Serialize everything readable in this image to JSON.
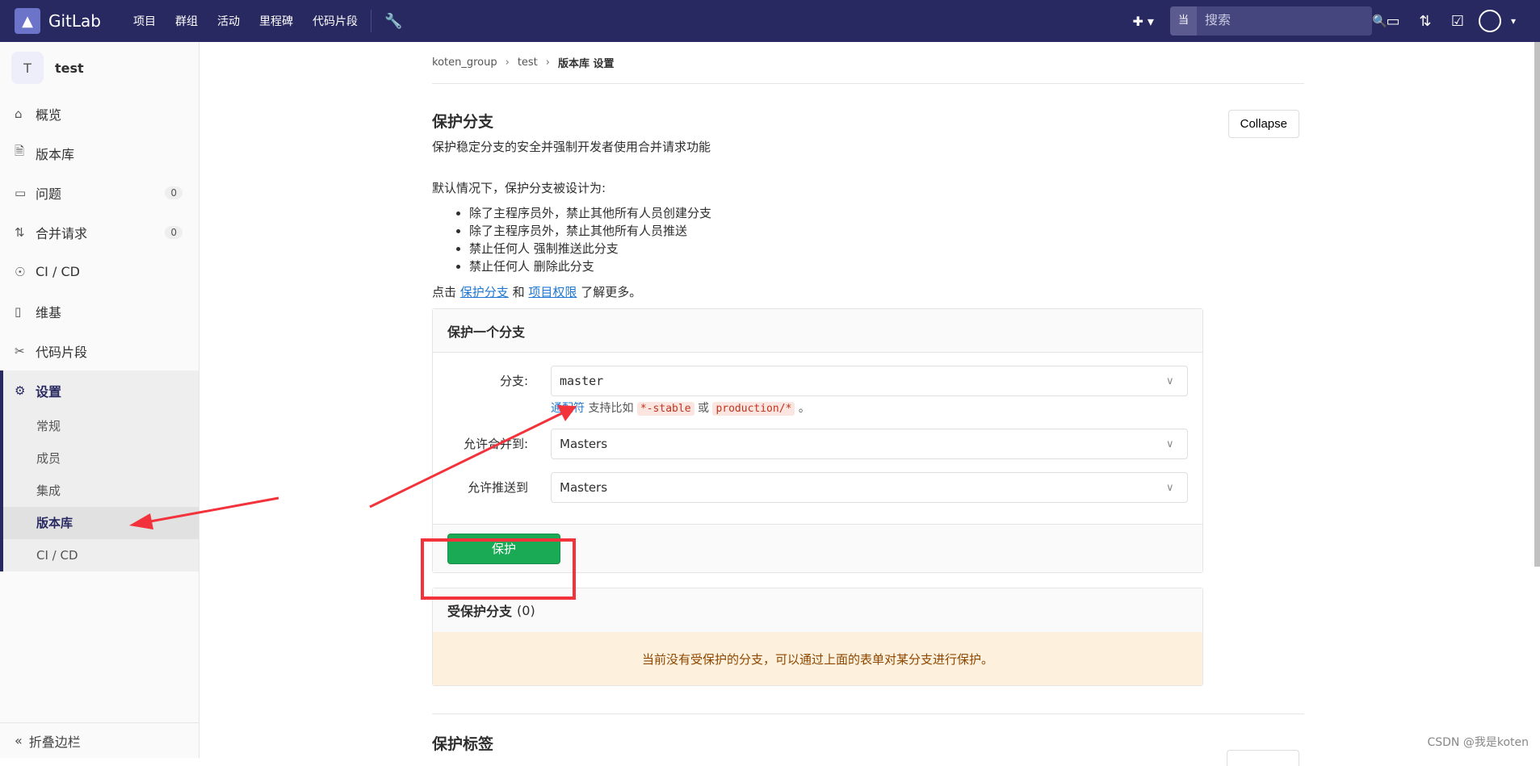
{
  "topbar": {
    "brand": "GitLab",
    "nav": [
      "项目",
      "群组",
      "活动",
      "里程碑",
      "代码片段"
    ],
    "search_scope": "当前项目",
    "search_placeholder": "搜索"
  },
  "sidebar": {
    "project_initial": "T",
    "project_name": "test",
    "items": [
      {
        "label": "概览",
        "icon": "home-icon"
      },
      {
        "label": "版本库",
        "icon": "doc-icon"
      },
      {
        "label": "问题",
        "icon": "issues-icon",
        "count": "0"
      },
      {
        "label": "合并请求",
        "icon": "merge-icon",
        "count": "0"
      },
      {
        "label": "CI / CD",
        "icon": "rocket-icon"
      },
      {
        "label": "维基",
        "icon": "book-icon"
      },
      {
        "label": "代码片段",
        "icon": "scissors-icon"
      }
    ],
    "settings_label": "设置",
    "settings_sub": [
      "常规",
      "成员",
      "集成",
      "版本库",
      "CI / CD"
    ],
    "collapse_label": "折叠边栏"
  },
  "breadcrumbs": [
    "koten_group",
    "test",
    "版本库 设置"
  ],
  "section": {
    "title": "保护分支",
    "desc": "保护稳定分支的安全并强制开发者使用合并请求功能",
    "collapse_label": "Collapse",
    "defaults_intro": "默认情况下，保护分支被设计为:",
    "rules": [
      "除了主程序员外，禁止其他所有人员创建分支",
      "除了主程序员外，禁止其他所有人员推送",
      "禁止任何人 强制推送此分支",
      "禁止任何人 删除此分支"
    ],
    "more_prefix": "点击",
    "more_link1": "保护分支",
    "more_and": "和",
    "more_link2": "项目权限",
    "more_suffix": "了解更多。"
  },
  "form": {
    "heading": "保护一个分支",
    "branch_label": "分支:",
    "branch_value": "master",
    "hint_link": "通配符",
    "hint_text": "支持比如",
    "hint_code1": "*-stable",
    "hint_or": "或",
    "hint_code2": "production/*",
    "hint_end": "。",
    "merge_label": "允许合并到:",
    "merge_value": "Masters",
    "push_label": "允许推送到",
    "push_value": "Masters",
    "submit_label": "保护"
  },
  "protected": {
    "heading": "受保护分支",
    "count": "(0)",
    "empty_msg": "当前没有受保护的分支，可以通过上面的表单对某分支进行保护。"
  },
  "next_section_title": "保护标签",
  "watermark": "CSDN @我是koten",
  "colors": {
    "nav_bg": "#292961",
    "primary_green": "#1aaa55",
    "annotation_red": "#f2333b"
  }
}
